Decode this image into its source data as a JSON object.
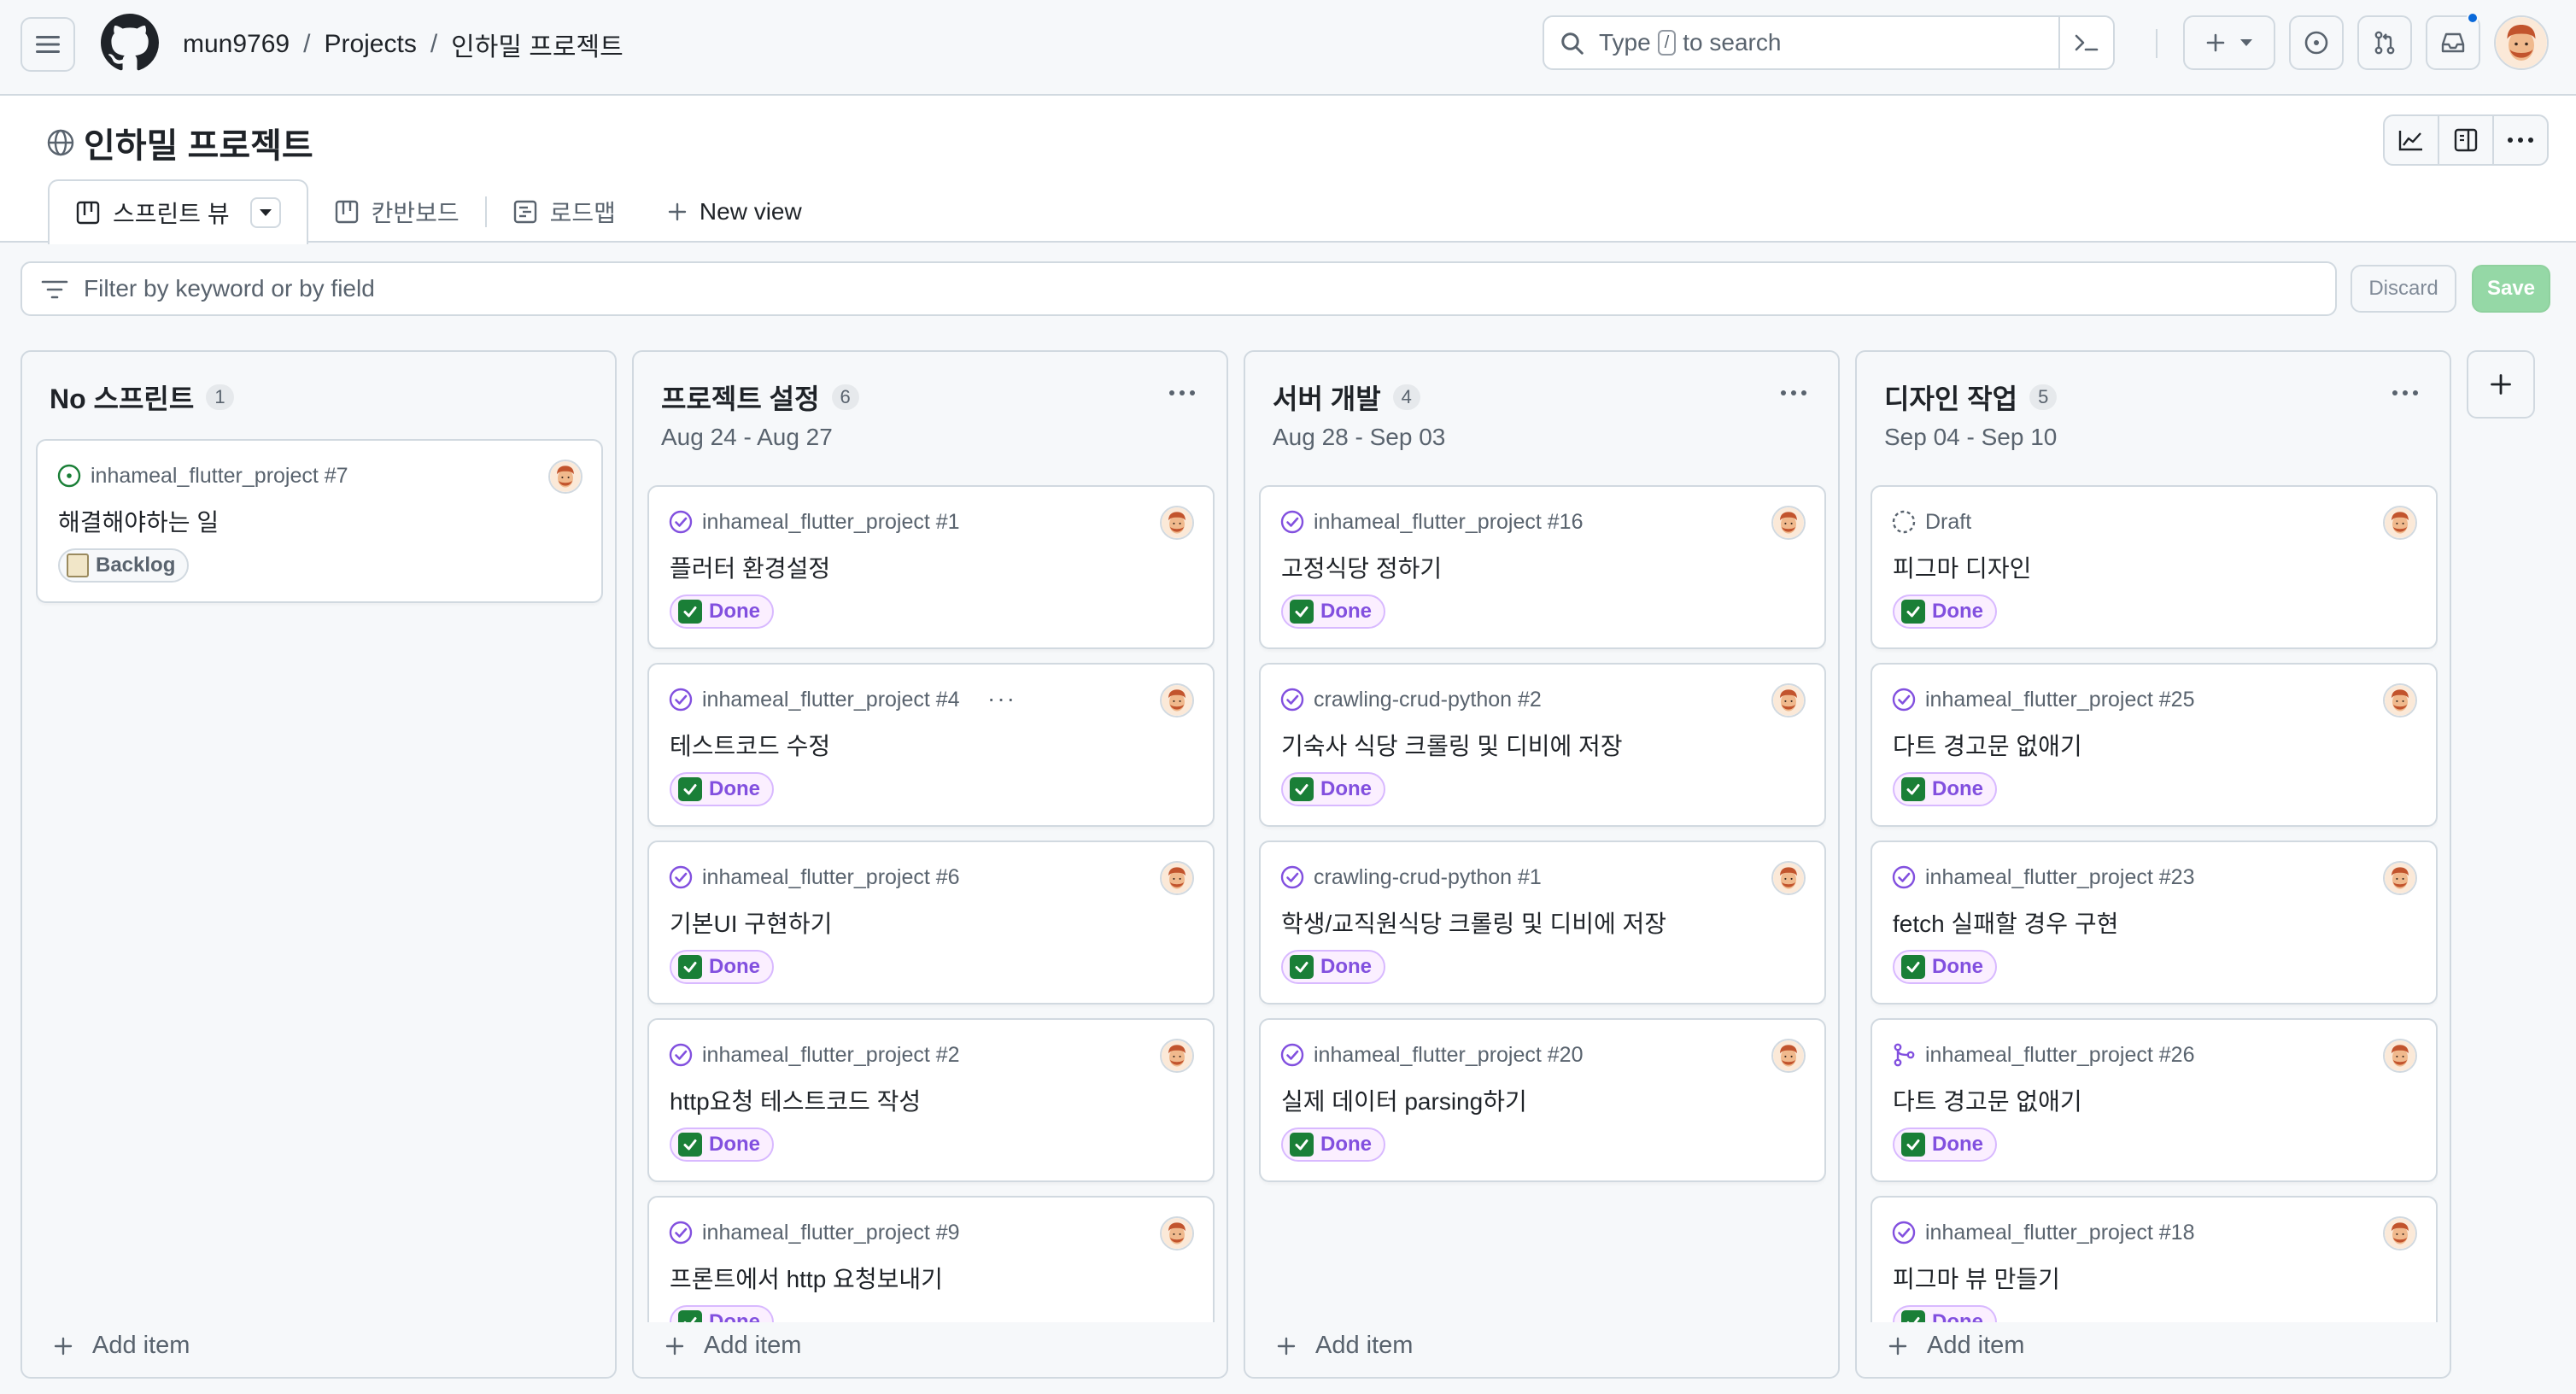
{
  "header": {
    "breadcrumbs": [
      "mun9769",
      "Projects",
      "인하밀 프로젝트"
    ],
    "search": {
      "prefix": "Type",
      "key": "/",
      "suffix": "to search"
    }
  },
  "project": {
    "title": "인하밀 프로젝트",
    "tabs": [
      {
        "label": "스프린트 뷰",
        "icon": "board-icon",
        "active": true
      },
      {
        "label": "칸반보드",
        "icon": "board-icon",
        "active": false
      },
      {
        "label": "로드맵",
        "icon": "roadmap-icon",
        "active": false
      }
    ],
    "new_view": "New view"
  },
  "filter": {
    "placeholder": "Filter by keyword or by field",
    "discard": "Discard",
    "save": "Save"
  },
  "board": {
    "add_item": "Add item",
    "status_colors": {
      "open": "#1a7f37",
      "closed": "#8250df",
      "draft": "#59636e"
    },
    "columns": [
      {
        "name": "No 스프린트",
        "count": "1",
        "dates": "",
        "cards": [
          {
            "meta": "inhameal_flutter_project #7",
            "state": "open",
            "title": "해결해야하는 일",
            "badge": "Backlog"
          }
        ]
      },
      {
        "name": "프로젝트 설정",
        "count": "6",
        "dates": "Aug 24 - Aug 27",
        "cards": [
          {
            "meta": "inhameal_flutter_project #1",
            "state": "closed",
            "title": "플러터 환경설정",
            "badge": "Done"
          },
          {
            "meta": "inhameal_flutter_project #4",
            "state": "closed",
            "title": "테스트코드 수정",
            "badge": "Done",
            "more": "···"
          },
          {
            "meta": "inhameal_flutter_project #6",
            "state": "closed",
            "title": "기본UI 구현하기",
            "badge": "Done"
          },
          {
            "meta": "inhameal_flutter_project #2",
            "state": "closed",
            "title": "http요청 테스트코드 작성",
            "badge": "Done"
          },
          {
            "meta": "inhameal_flutter_project #9",
            "state": "closed",
            "title": "프론트에서 http 요청보내기",
            "badge": "Done"
          }
        ]
      },
      {
        "name": "서버 개발",
        "count": "4",
        "dates": "Aug 28 - Sep 03",
        "cards": [
          {
            "meta": "inhameal_flutter_project #16",
            "state": "closed",
            "title": "고정식당 정하기",
            "badge": "Done"
          },
          {
            "meta": "crawling-crud-python #2",
            "state": "closed",
            "title": "기숙사 식당 크롤링 및 디비에 저장",
            "badge": "Done"
          },
          {
            "meta": "crawling-crud-python #1",
            "state": "closed",
            "title": "학생/교직원식당 크롤링 및 디비에 저장",
            "badge": "Done"
          },
          {
            "meta": "inhameal_flutter_project #20",
            "state": "closed",
            "title": "실제 데이터 parsing하기",
            "badge": "Done"
          }
        ]
      },
      {
        "name": "디자인 작업",
        "count": "5",
        "dates": "Sep 04 - Sep 10",
        "cards": [
          {
            "meta": "Draft",
            "state": "draft",
            "title": "피그마 디자인",
            "badge": "Done"
          },
          {
            "meta": "inhameal_flutter_project #25",
            "state": "closed",
            "title": "다트 경고문 없애기",
            "badge": "Done"
          },
          {
            "meta": "inhameal_flutter_project #23",
            "state": "closed",
            "title": "fetch 실패할 경우 구현",
            "badge": "Done"
          },
          {
            "meta": "inhameal_flutter_project #26",
            "state": "merged",
            "title": "다트 경고문 없애기",
            "badge": "Done"
          },
          {
            "meta": "inhameal_flutter_project #18",
            "state": "closed",
            "title": "피그마 뷰 만들기",
            "badge": "Done"
          }
        ]
      }
    ]
  }
}
